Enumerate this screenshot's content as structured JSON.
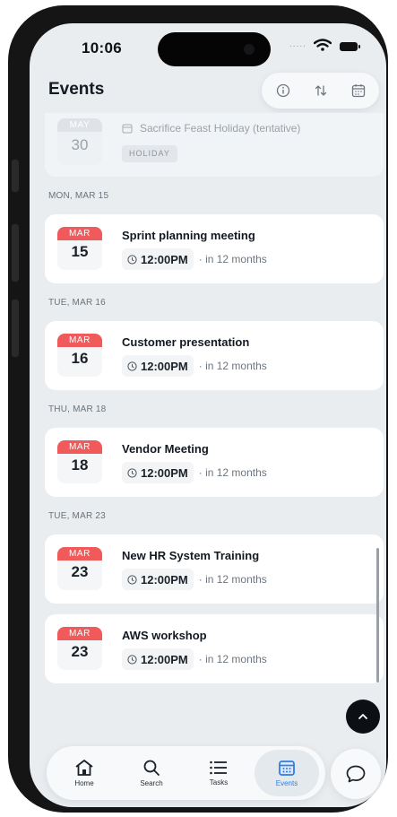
{
  "status": {
    "time": "10:06",
    "signal_dots": "....."
  },
  "header": {
    "title": "Events"
  },
  "holiday": {
    "month": "MAY",
    "day": "30",
    "title": "Sacrifice Feast Holiday (tentative)",
    "tag": "HOLIDAY"
  },
  "sections": [
    {
      "label": "MON, MAR 15"
    },
    {
      "label": "TUE, MAR 16"
    },
    {
      "label": "THU, MAR 18"
    },
    {
      "label": "TUE, MAR 23"
    }
  ],
  "events": [
    {
      "month": "MAR",
      "day": "15",
      "title": "Sprint planning meeting",
      "time": "12:00PM",
      "relative": "· in 12 months"
    },
    {
      "month": "MAR",
      "day": "16",
      "title": "Customer presentation",
      "time": "12:00PM",
      "relative": "· in 12 months"
    },
    {
      "month": "MAR",
      "day": "18",
      "title": "Vendor Meeting",
      "time": "12:00PM",
      "relative": "· in 12 months"
    },
    {
      "month": "MAR",
      "day": "23",
      "title": "New HR System Training",
      "time": "12:00PM",
      "relative": "· in 12 months"
    },
    {
      "month": "MAR",
      "day": "23",
      "title": "AWS workshop",
      "time": "12:00PM",
      "relative": "· in 12 months"
    }
  ],
  "tabs": [
    {
      "label": "Home",
      "icon": "home-icon"
    },
    {
      "label": "Search",
      "icon": "search-icon"
    },
    {
      "label": "Tasks",
      "icon": "list-icon"
    },
    {
      "label": "Events",
      "icon": "calendar-icon",
      "active": true
    }
  ],
  "colors": {
    "accent": "#2f7de1",
    "month_badge": "#f05a5a",
    "background": "#e9edf0"
  }
}
